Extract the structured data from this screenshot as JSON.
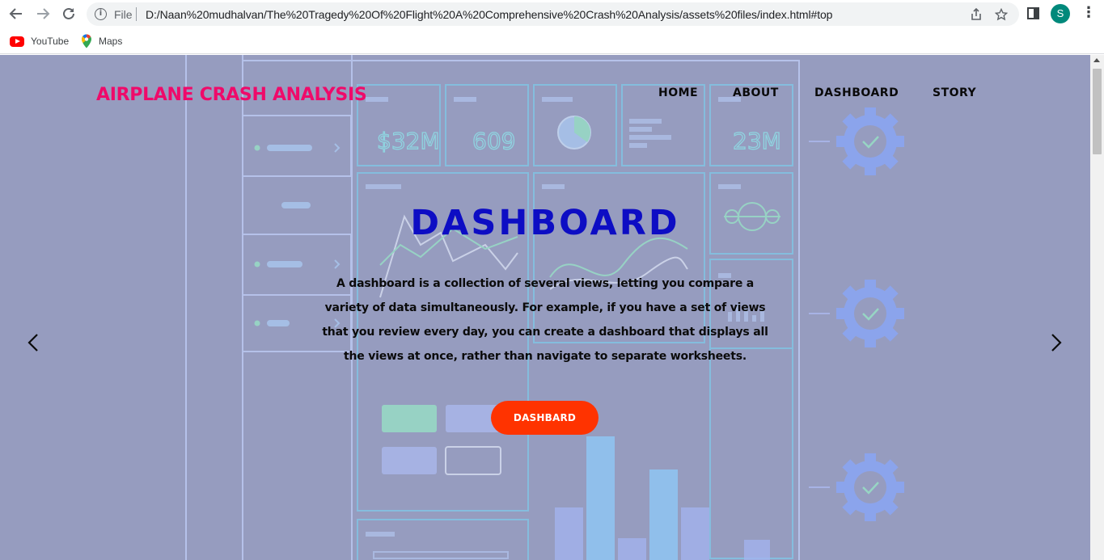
{
  "browser": {
    "scheme_label": "File",
    "url": "D:/Naan%20mudhalvan/The%20Tragedy%20Of%20Flight%20A%20Comprehensive%20Crash%20Analysis/assets%20files/index.html#top",
    "avatar_letter": "S",
    "icons": [
      "back-icon",
      "forward-icon",
      "reload-icon",
      "info-icon",
      "share-icon",
      "star-icon",
      "side-panel-icon",
      "menu-icon"
    ],
    "bookmarks": [
      {
        "label": "YouTube",
        "icon": "youtube-icon"
      },
      {
        "label": "Maps",
        "icon": "maps-icon"
      }
    ]
  },
  "site": {
    "brand": "AIRPLANE CRASH ANALYSIS",
    "nav": [
      "HOME",
      "ABOUT",
      "DASHBOARD",
      "STORY"
    ],
    "hero": {
      "title": "DASHBOARD",
      "lines": [
        "A dashboard is a collection of several views, letting you compare a",
        "variety of data simultaneously. For example, if you have a set of views",
        "that you review every day, you can create a dashboard that displays all",
        "the views at once, rather than navigate to separate worksheets."
      ],
      "button": "DASHBARD"
    },
    "background_tiles": {
      "kpi_1": "$32M",
      "kpi_2": "609",
      "kpi_3": "23M"
    },
    "colors": {
      "brand": "#ef0a6a",
      "hero_title": "#0d0dc4",
      "button": "#ff3300",
      "overlay": "#969cbf"
    }
  }
}
